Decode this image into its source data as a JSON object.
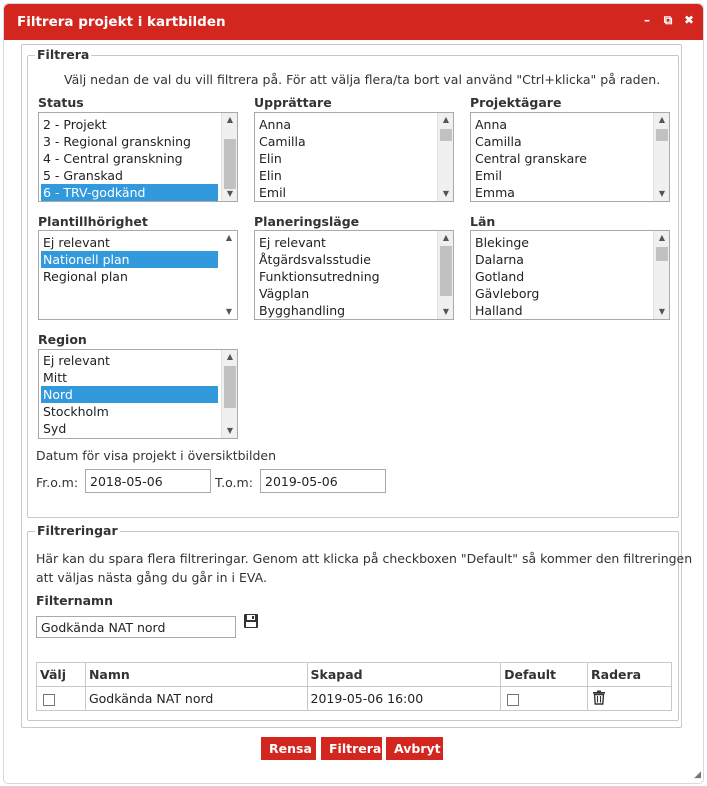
{
  "dialog": {
    "title": "Filtrera projekt i kartbilden",
    "controls": [
      "–",
      "⧉",
      "✖"
    ],
    "accent": "#d2261f"
  },
  "filtrera": {
    "legend": "Filtrera",
    "info": "Välj nedan de val du vill filtrera på. För att välja flera/ta bort val använd \"Ctrl+klicka\" på raden.",
    "status": {
      "label": "Status",
      "options": [
        "2 - Projekt",
        "3 - Regional granskning",
        "4 - Central granskning",
        "5 - Granskad",
        "6 - TRV-godkänd"
      ],
      "selected": "6 - TRV-godkänd"
    },
    "upprattare": {
      "label": "Upprättare",
      "options": [
        "Anna",
        "Camilla",
        "Elin",
        "Elin",
        "Emil"
      ]
    },
    "projektagare": {
      "label": "Projektägare",
      "options": [
        "Anna",
        "Camilla",
        "Central granskare",
        "Emil",
        "Emma"
      ]
    },
    "plantillhorighet": {
      "label": "Plantillhörighet",
      "options": [
        "Ej relevant",
        "Nationell plan",
        "Regional plan"
      ],
      "selected": "Nationell plan"
    },
    "planeringslage": {
      "label": "Planeringsläge",
      "options": [
        "Ej relevant",
        "Åtgärdsvalsstudie",
        "Funktionsutredning",
        "Vägplan",
        "Bygghandling"
      ]
    },
    "lan": {
      "label": "Län",
      "options": [
        "Blekinge",
        "Dalarna",
        "Gotland",
        "Gävleborg",
        "Halland"
      ]
    },
    "region": {
      "label": "Region",
      "options": [
        "Ej relevant",
        "Mitt",
        "Nord",
        "Stockholm",
        "Syd"
      ],
      "selected": "Nord"
    },
    "datum": {
      "heading": "Datum för visa projekt i översiktbilden",
      "from_label": "Fr.o.m:",
      "from_value": "2018-05-06",
      "to_label": "T.o.m:",
      "to_value": "2019-05-06"
    }
  },
  "filtreringar": {
    "legend": "Filtreringar",
    "info": "Här kan du spara flera filtreringar. Genom att klicka på checkboxen \"Default\" så kommer den filtreringen",
    "info2": "att väljas nästa gång du går in i EVA.",
    "filternamn_label": "Filternamn",
    "filternamn_value": "Godkända NAT nord",
    "table": {
      "headers": [
        "Välj",
        "Namn",
        "Skapad",
        "Default",
        "Radera"
      ],
      "rows": [
        {
          "namn": "Godkända NAT nord",
          "skapad": "2019-05-06 16:00"
        }
      ]
    }
  },
  "buttons": {
    "rensa": "Rensa",
    "filtrera": "Filtrera",
    "avbryt": "Avbryt"
  }
}
